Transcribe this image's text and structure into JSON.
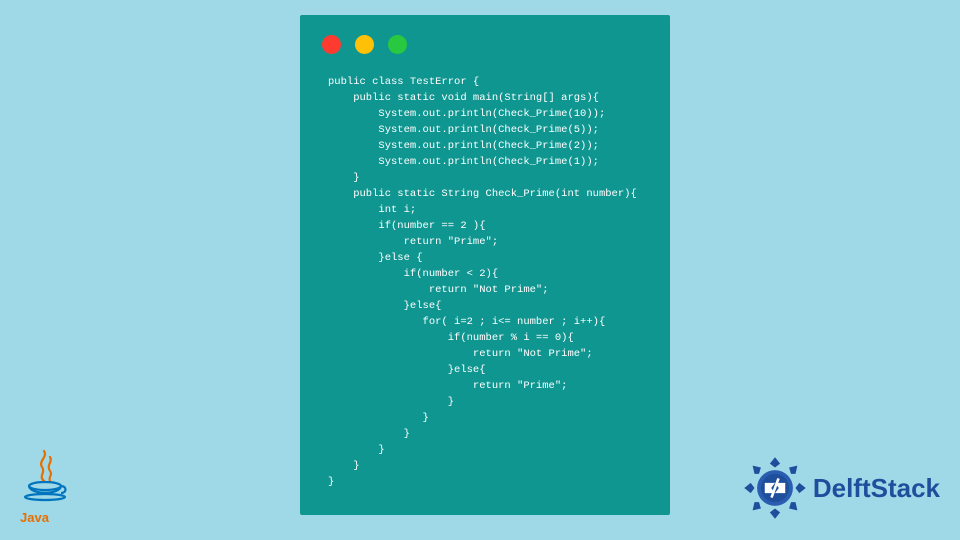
{
  "window": {
    "traffic_lights": [
      "red",
      "yellow",
      "green"
    ]
  },
  "code": {
    "lines": [
      "public class TestError {",
      "    public static void main(String[] args){",
      "        System.out.println(Check_Prime(10));",
      "        System.out.println(Check_Prime(5));",
      "        System.out.println(Check_Prime(2));",
      "        System.out.println(Check_Prime(1));",
      "    }",
      "    public static String Check_Prime(int number){",
      "        int i;",
      "        if(number == 2 ){",
      "            return \"Prime\";",
      "        }else {",
      "            if(number < 2){",
      "                return \"Not Prime\";",
      "            }else{",
      "               for( i=2 ; i<= number ; i++){",
      "                   if(number % i == 0){",
      "                       return \"Not Prime\";",
      "                   }else{",
      "                       return \"Prime\";",
      "                   }",
      "               }",
      "            }",
      "        }",
      "    }",
      "}"
    ]
  },
  "logos": {
    "java_label": "Java",
    "delft_label": "DelftStack"
  }
}
